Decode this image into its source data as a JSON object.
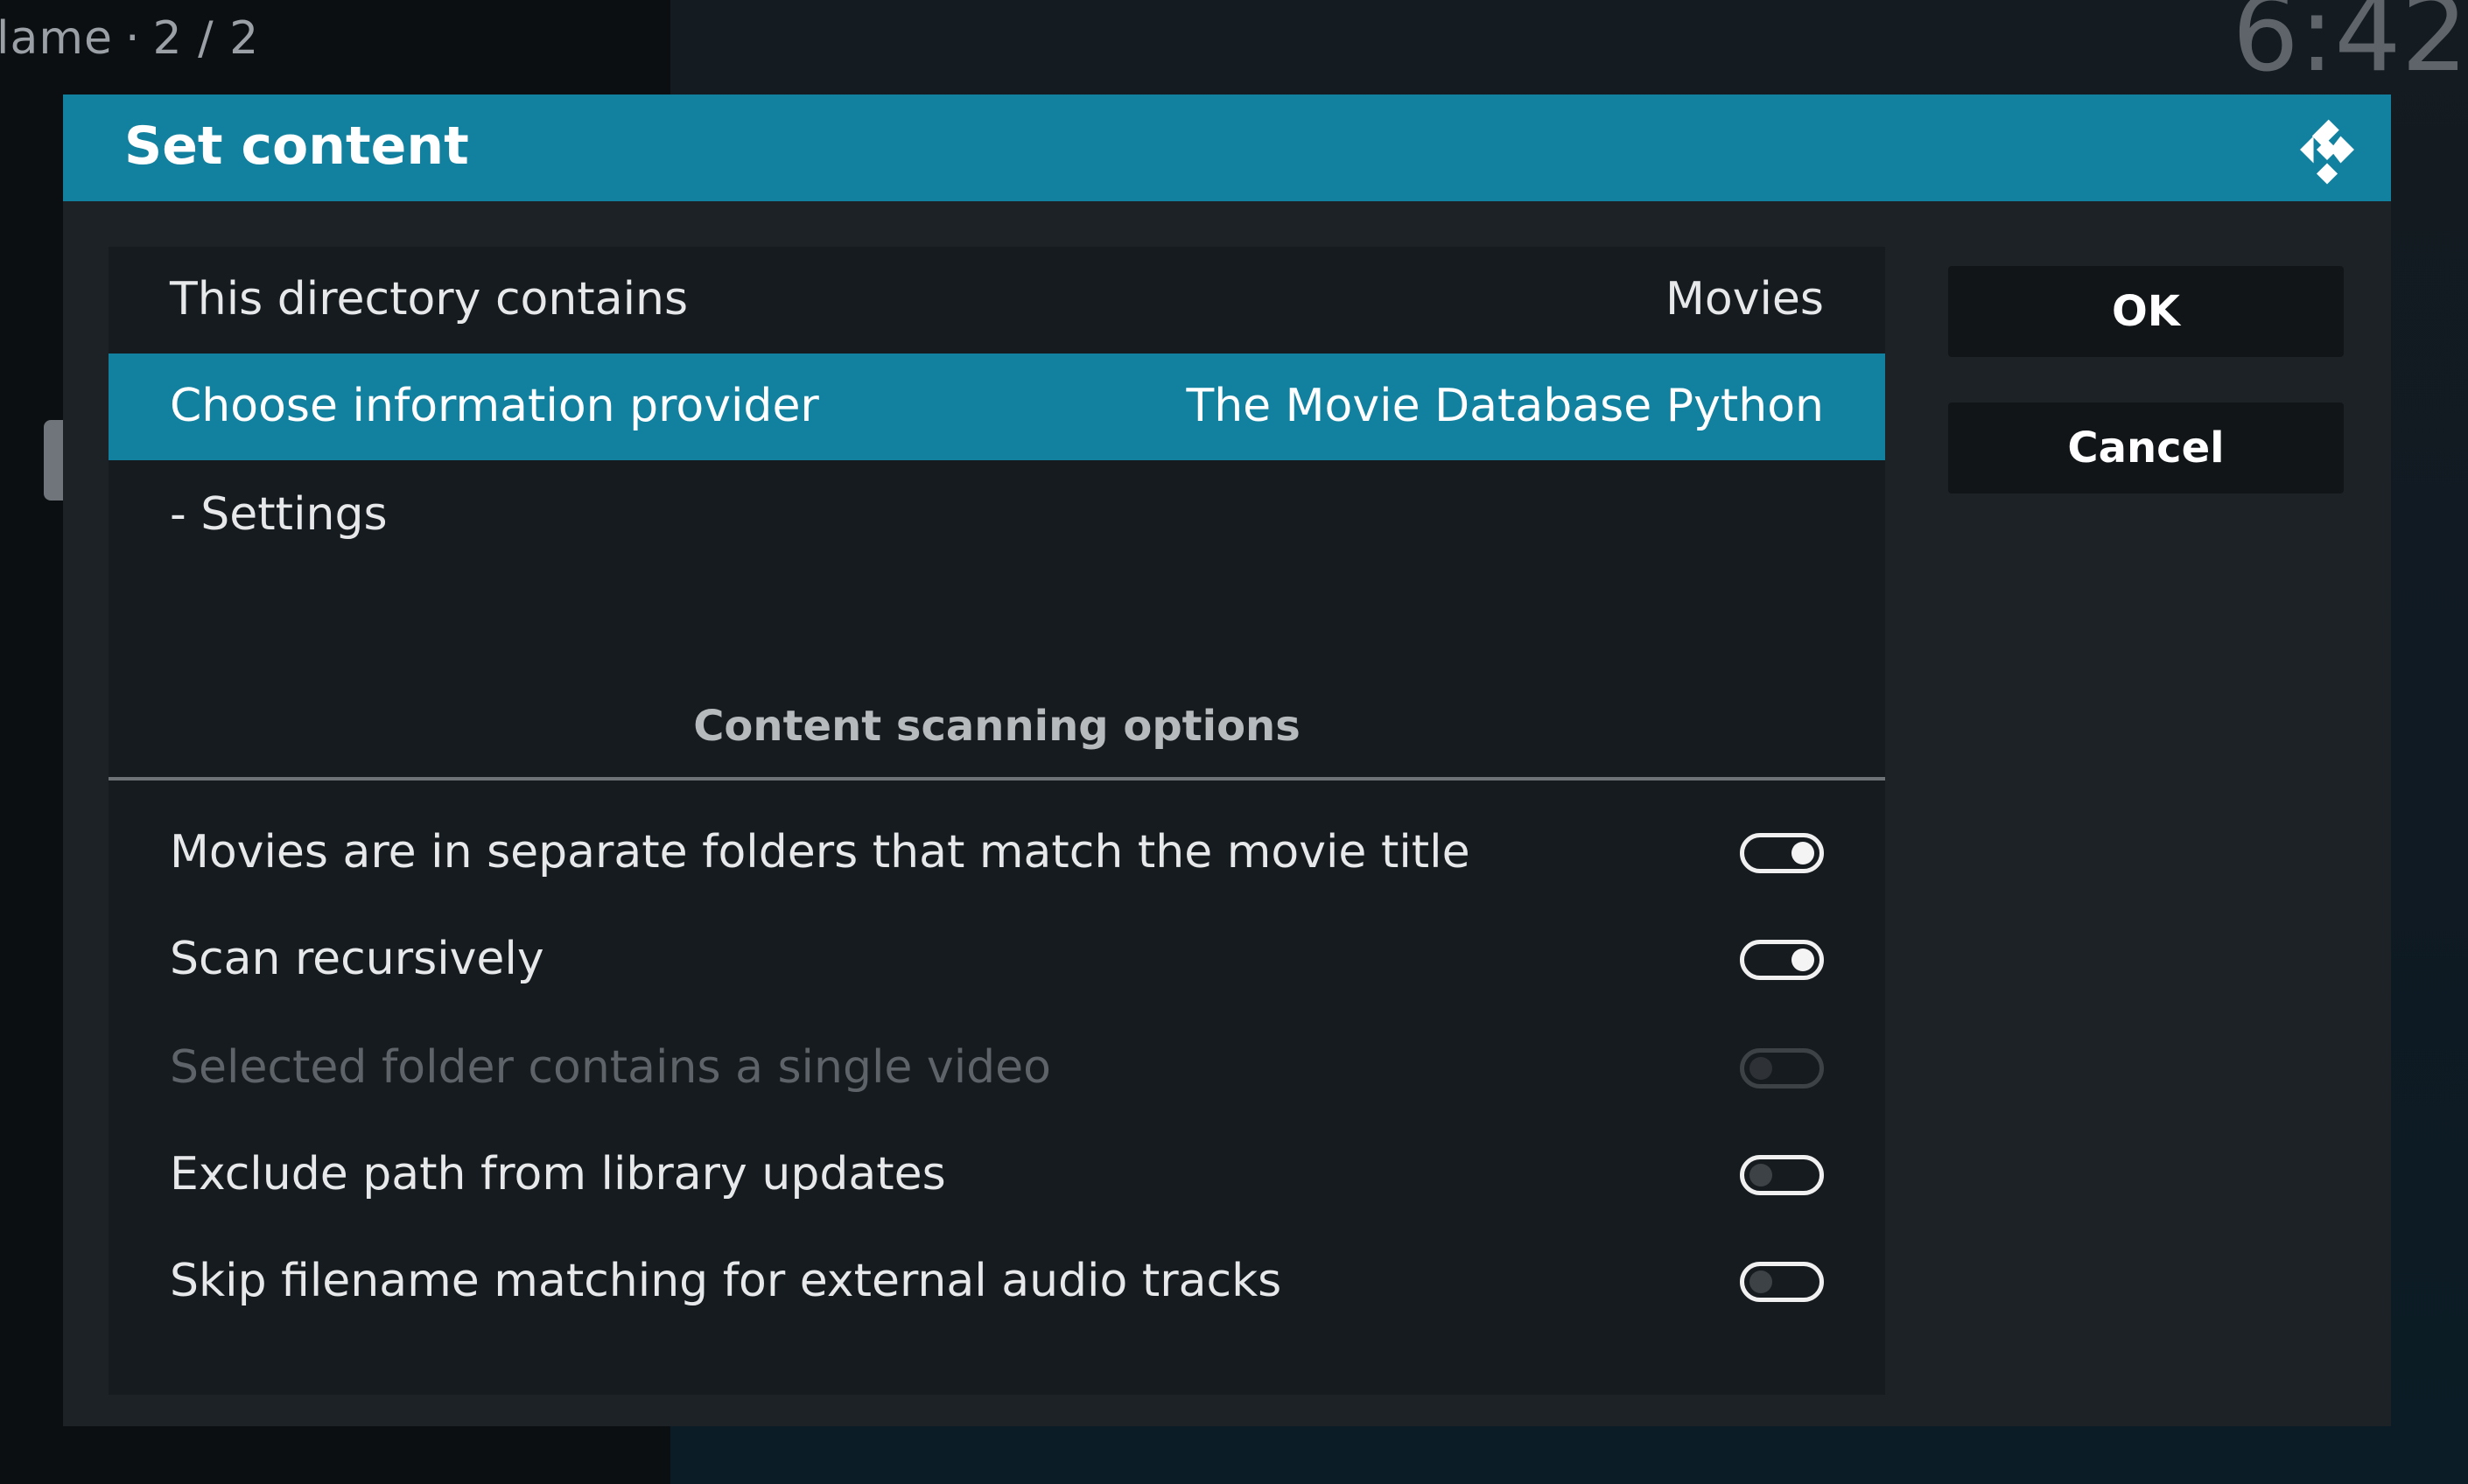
{
  "background": {
    "breadcrumb_name": "lame",
    "breadcrumb_separator": "·",
    "breadcrumb_page": "2 / 2",
    "clock_partial": "6:42"
  },
  "dialog": {
    "title": "Set content",
    "logo_icon": "kodi-logo-icon",
    "header_color": "#12819f"
  },
  "settings": {
    "directory_contains_label": "This directory contains",
    "directory_contains_value": "Movies",
    "provider_label": "Choose information provider",
    "provider_value": "The Movie Database Python",
    "settings_label": "- Settings",
    "section_title": "Content scanning options"
  },
  "options": [
    {
      "label": "Movies are in separate folders that match the movie title",
      "state": "on",
      "enabled": true
    },
    {
      "label": "Scan recursively",
      "state": "on",
      "enabled": true
    },
    {
      "label": "Selected folder contains a single video",
      "state": "off",
      "enabled": false
    },
    {
      "label": "Exclude path from library updates",
      "state": "off",
      "enabled": true
    },
    {
      "label": "Skip filename matching for external audio tracks",
      "state": "off",
      "enabled": true
    }
  ],
  "buttons": {
    "ok_label": "OK",
    "cancel_label": "Cancel"
  }
}
